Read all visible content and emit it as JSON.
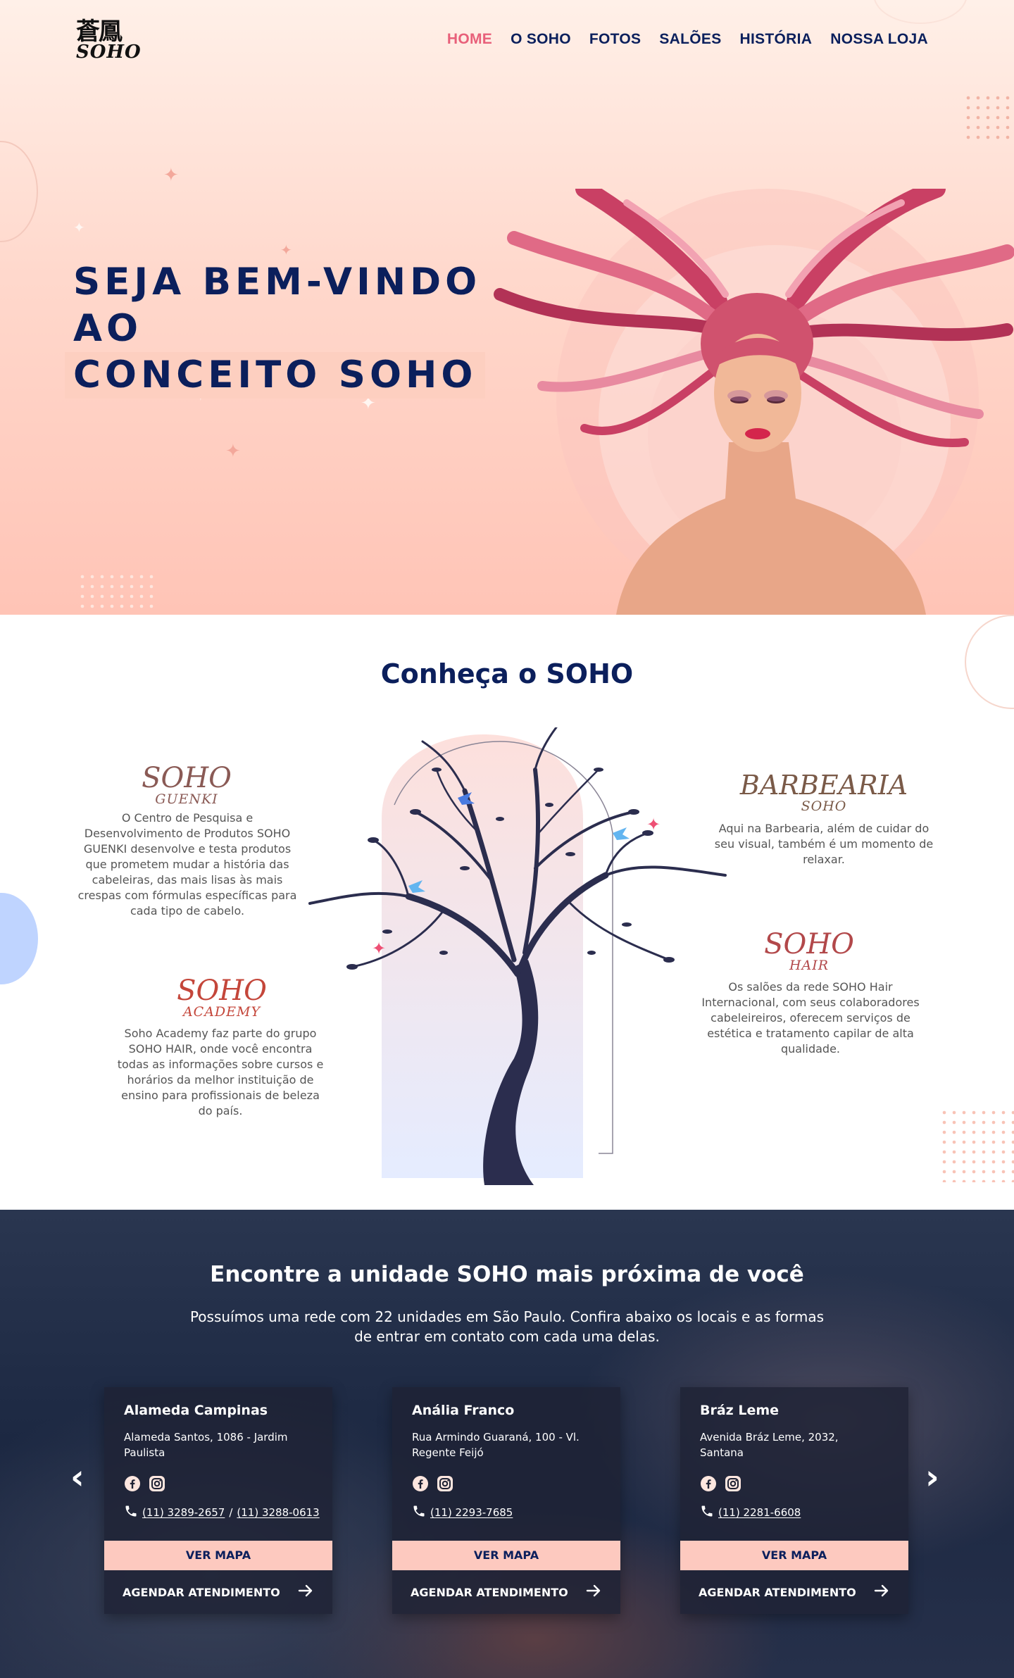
{
  "header": {
    "logo_cjk": "蒼鳳",
    "logo_word": "SOHO",
    "nav": [
      "HOME",
      "O SOHO",
      "FOTOS",
      "SALÕES",
      "HISTÓRIA",
      "NOSSA LOJA"
    ]
  },
  "hero": {
    "title_line1": "SEJA BEM-VINDO AO",
    "title_line2": "CONCEITO SOHO"
  },
  "about": {
    "title": "Conheça o SOHO",
    "brands": [
      {
        "big": "SOHO",
        "small": "GUENKI",
        "text": "O Centro de Pesquisa e Desenvolvimento de Produtos SOHO GUENKI desenvolve e testa produtos que prometem mudar a história das cabeleiras, das mais lisas às mais crespas com fórmulas específicas para cada tipo de cabelo."
      },
      {
        "big": "SOHO",
        "small": "ACADEMY",
        "text": "Soho Academy faz parte do grupo SOHO HAIR, onde você encontra todas as informações sobre cursos e horários da melhor instituição de ensino para profissionais de beleza do país."
      },
      {
        "big": "BARBEARIA",
        "small": "SOHO",
        "text": "Aqui na Barbearia, além de cuidar do seu visual, também é um momento de relaxar."
      },
      {
        "big": "SOHO",
        "small": "HAIR",
        "text": "Os salões da rede SOHO Hair Internacional, com seus colaboradores cabeleireiros, oferecem serviços de estética e tratamento capilar de alta qualidade."
      }
    ]
  },
  "units": {
    "title": "Encontre a unidade SOHO mais próxima de você",
    "subtitle": "Possuímos uma rede com 22 unidades em São Paulo. Confira abaixo os locais e as formas de entrar em contato com cada uma delas.",
    "prev": "‹",
    "next": "›",
    "map_label": "VER MAPA",
    "schedule_label": "AGENDAR ATENDIMENTO",
    "cards": [
      {
        "name": "Alameda Campinas",
        "address": "Alameda Santos, 1086 - Jardim Paulista",
        "phone1": "(11) 3289-2657",
        "sep": " / ",
        "phone2": "(11) 3288-0613"
      },
      {
        "name": "Anália Franco",
        "address": "Rua Armindo Guaraná, 100 - Vl. Regente Feijó",
        "phone1": "(11) 2293-7685",
        "sep": "",
        "phone2": ""
      },
      {
        "name": "Bráz Leme",
        "address": "Avenida Bráz Leme, 2032, Santana",
        "phone1": "(11) 2281-6608",
        "sep": "",
        "phone2": ""
      }
    ]
  },
  "colors": {
    "navy": "#0b1f5c",
    "accent_pink": "#e8607a",
    "button_peach": "#fdc9bf",
    "guenki_brown": "#8a5a55",
    "academy_red": "#c4463a",
    "barbearia_brown": "#7a5a48",
    "hair_red": "#b2484a"
  }
}
